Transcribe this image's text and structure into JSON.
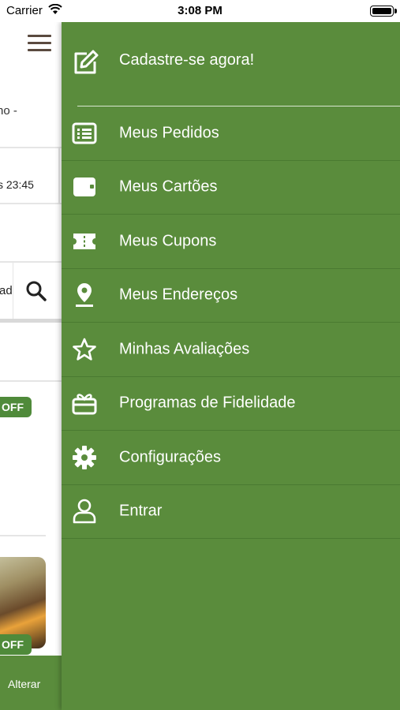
{
  "status_bar": {
    "carrier": "Carrier",
    "time": "3:08 PM"
  },
  "background": {
    "address_fragment": "ho -",
    "hours_fragment": "s 23:45",
    "search_fragment": "ad",
    "badge1": "OFF",
    "badge2": "OFF",
    "footer_action": "Alterar"
  },
  "drawer": {
    "header_label": "Cadastre-se agora!",
    "items": [
      {
        "label": "Meus Pedidos",
        "icon": "list-icon"
      },
      {
        "label": "Meus Cartões",
        "icon": "wallet-icon"
      },
      {
        "label": "Meus Cupons",
        "icon": "ticket-icon"
      },
      {
        "label": "Meus Endereços",
        "icon": "location-pin-icon"
      },
      {
        "label": "Minhas Avaliações",
        "icon": "star-icon"
      },
      {
        "label": "Programas de Fidelidade",
        "icon": "gift-icon"
      },
      {
        "label": "Configurações",
        "icon": "gear-icon"
      },
      {
        "label": "Entrar",
        "icon": "user-icon"
      }
    ]
  },
  "colors": {
    "drawer_bg": "#5a8c3c",
    "badge": "#4f8a3a",
    "hamburger": "#5a4a3f"
  }
}
